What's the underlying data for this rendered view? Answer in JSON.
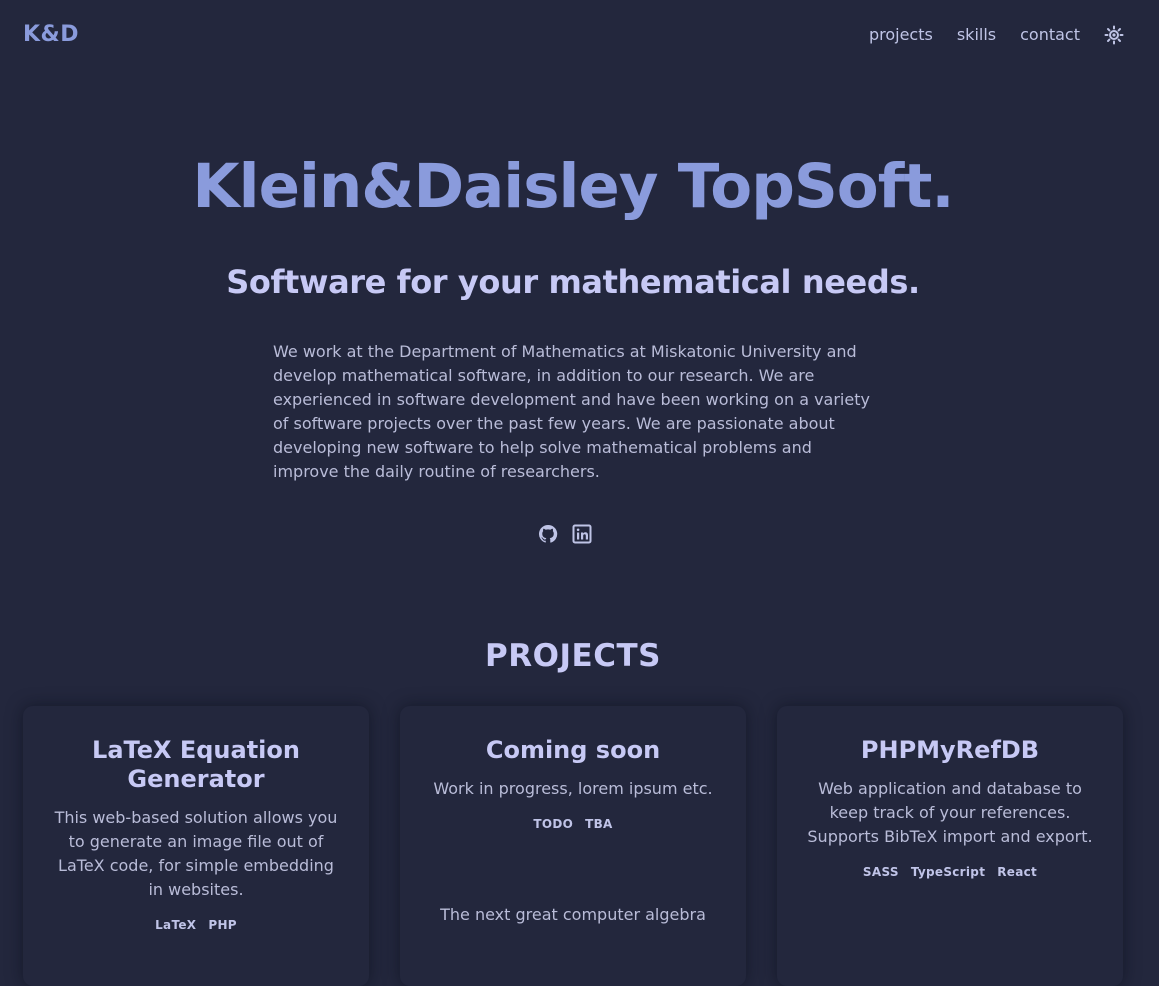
{
  "header": {
    "logo": "K&D",
    "nav": [
      "projects",
      "skills",
      "contact"
    ],
    "theme_toggle_icon": "sun-icon"
  },
  "hero": {
    "title": "Klein&Daisley TopSoft.",
    "subtitle": "Software for your mathematical needs.",
    "description": "We work at the Department of Mathematics at Miskatonic University and develop mathematical software, in addition to our research. We are experienced in software development and have been working on a variety of software projects over the past few years. We are passionate about developing new software to help solve mathematical problems and improve the daily routine of researchers.",
    "socials": [
      "github-icon",
      "linkedin-icon"
    ]
  },
  "projects": {
    "title": "PROJECTS",
    "items": [
      {
        "title": "LaTeX Equation Generator",
        "description": "This web-based solution allows you to generate an image file out of LaTeX code, for simple embedding in websites.",
        "tags": [
          "LaTeX",
          "PHP"
        ]
      },
      {
        "title": "Coming soon",
        "description": "Work in progress, lorem ipsum etc.",
        "tags": [
          "TODO",
          "TBA"
        ],
        "extra": "The next great computer algebra"
      },
      {
        "title": "PHPMyRefDB",
        "description": "Web application and database to keep track of your references. Supports BibTeX import and export.",
        "tags": [
          "SASS",
          "TypeScript",
          "React"
        ]
      }
    ]
  },
  "colors": {
    "background": "#23273d",
    "accent": "#8a9bdc",
    "heading": "#c7c9f5",
    "text": "#b9bcd8"
  }
}
